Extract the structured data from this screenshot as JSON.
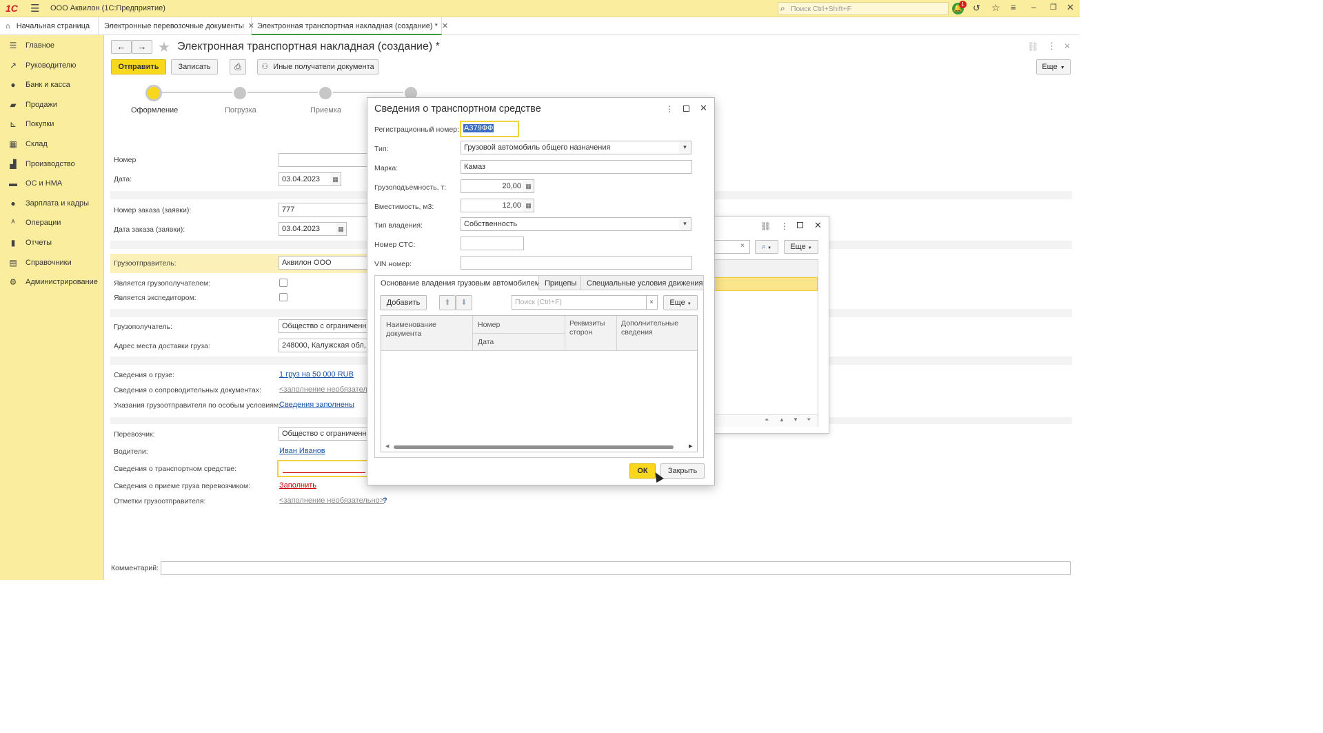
{
  "titlebar": {
    "app_title": "ООО Аквилон  (1С:Предприятие)",
    "search_placeholder": "Поиск Ctrl+Shift+F",
    "notify_count": "1"
  },
  "tabs": [
    {
      "label": "Начальная страница"
    },
    {
      "label": "Электронные перевозочные документы"
    },
    {
      "label": "Электронная транспортная накладная (создание) *"
    }
  ],
  "sidebar": {
    "items": [
      {
        "label": "Главное",
        "icon": "menu-icon"
      },
      {
        "label": "Руководителю",
        "icon": "trend-icon"
      },
      {
        "label": "Банк и касса",
        "icon": "coin-icon"
      },
      {
        "label": "Продажи",
        "icon": "bag-icon"
      },
      {
        "label": "Покупки",
        "icon": "cart-icon"
      },
      {
        "label": "Склад",
        "icon": "warehouse-icon"
      },
      {
        "label": "Производство",
        "icon": "factory-icon"
      },
      {
        "label": "ОС и НМА",
        "icon": "truck-icon"
      },
      {
        "label": "Зарплата и кадры",
        "icon": "person-icon"
      },
      {
        "label": "Операции",
        "icon": "operations-icon"
      },
      {
        "label": "Отчеты",
        "icon": "chart-icon"
      },
      {
        "label": "Справочники",
        "icon": "book-icon"
      },
      {
        "label": "Администрирование",
        "icon": "gear-icon"
      }
    ]
  },
  "doc": {
    "title": "Электронная транспортная накладная (создание) *",
    "btn_send": "Отправить",
    "btn_save": "Записать",
    "btn_recipients": "Иные получатели документа",
    "btn_more": "Еще",
    "steps": [
      "Оформление",
      "Погрузка",
      "Приемка"
    ],
    "fields": {
      "number_label": "Номер",
      "number_value": "",
      "date_label": "Дата:",
      "date_value": "03.04.2023",
      "order_number_label": "Номер заказа (заявки):",
      "order_number_value": "777",
      "order_date_label": "Дата заказа (заявки):",
      "order_date_value": "03.04.2023",
      "shipper_label": "Грузоотправитель:",
      "shipper_value": "Аквилон ООО",
      "is_consignee_label": "Является грузополучателем:",
      "is_forwarder_label": "Является экспедитором:",
      "consignee_label": "Грузополучатель:",
      "consignee_value": "Общество с ограниченно",
      "address_label": "Адрес места доставки груза:",
      "address_value": "248000, Калужская обл, г",
      "cargo_label": "Сведения о грузе:",
      "cargo_value": "1 груз на 50 000 RUB",
      "docs_label": "Сведения о сопроводительных документах:",
      "docs_value": "<заполнение необязатель",
      "special_label": "Указания грузоотправителя по особым условиям:",
      "special_value": "Сведения заполнены",
      "carrier_label": "Перевозчик:",
      "carrier_value": "Общество с ограниченно",
      "drivers_label": "Водители:",
      "drivers_value": "Иван Иванов",
      "vehicle_label": "Сведения о транспортном средстве:",
      "acceptance_label": "Сведения о приеме груза перевозчиком:",
      "acceptance_value": "Заполнить",
      "marks_label": "Отметки грузоотправителя:",
      "marks_value": "<заполнение необязательно>",
      "marks_help": "?",
      "comment_label": "Комментарий:"
    }
  },
  "behind": {
    "btn_more": "Еще",
    "clear": "×"
  },
  "modal": {
    "title": "Сведения о транспортном средстве",
    "reg_label": "Регистрационный номер:",
    "reg_value": "А379ФФ",
    "type_label": "Тип:",
    "type_value": "Грузовой автомобиль общего назначения",
    "brand_label": "Марка:",
    "brand_value": "Камаз",
    "capacity_label": "Грузоподъемность, т:",
    "capacity_value": "20,00",
    "volume_label": "Вместимость, м3:",
    "volume_value": "12,00",
    "ownership_label": "Тип владения:",
    "ownership_value": "Собственность",
    "sts_label": "Номер СТС:",
    "sts_value": "",
    "vin_label": "VIN номер:",
    "vin_value": "",
    "tabs": [
      "Основание владения грузовым автомобилем",
      "Прицепы",
      "Специальные условия движения"
    ],
    "btn_add": "Добавить",
    "search_placeholder": "Поиск (Ctrl+F)",
    "btn_more": "Еще",
    "columns": {
      "name": "Наименование документа",
      "number": "Номер",
      "date": "Дата",
      "parties": "Реквизиты сторон",
      "extra": "Дополнительные сведения"
    },
    "btn_ok": "ОК",
    "btn_close": "Закрыть"
  }
}
